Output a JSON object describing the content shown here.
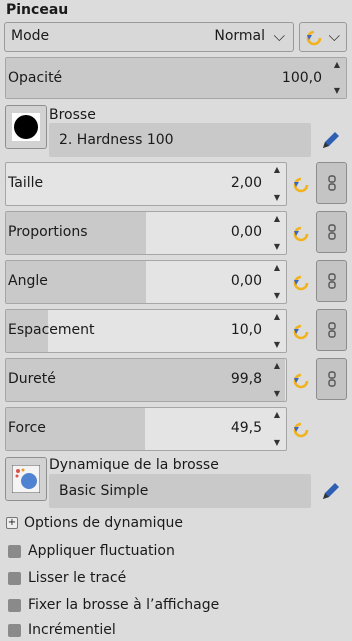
{
  "panel": {
    "title": "Pinceau"
  },
  "mode": {
    "label": "Mode",
    "value": "Normal",
    "reset_icon": "reset-icon"
  },
  "opacity": {
    "label": "Opacité",
    "value": "100,0",
    "fraction": 1.0
  },
  "brush": {
    "label": "Brosse",
    "name": "2. Hardness 100",
    "edit_icon": "pencil-icon"
  },
  "params": [
    {
      "label": "Taille",
      "value": "2,00",
      "fraction": 0.0,
      "chain": true
    },
    {
      "label": "Proportions",
      "value": "0,00",
      "fraction": 0.5,
      "chain": true
    },
    {
      "label": "Angle",
      "value": "0,00",
      "fraction": 0.5,
      "chain": true
    },
    {
      "label": "Espacement",
      "value": "10,0",
      "fraction": 0.15,
      "chain": true
    },
    {
      "label": "Dureté",
      "value": "99,8",
      "fraction": 0.998,
      "chain": true
    },
    {
      "label": "Force",
      "value": "49,5",
      "fraction": 0.495,
      "chain": false
    }
  ],
  "dynamics": {
    "label": "Dynamique de la brosse",
    "name": "Basic Simple",
    "edit_icon": "pencil-icon"
  },
  "dynamics_options": {
    "label": "Options de dynamique"
  },
  "checkboxes": [
    {
      "label": "Appliquer fluctuation",
      "checked": false
    },
    {
      "label": "Lisser le tracé",
      "checked": false
    },
    {
      "label": "Fixer la brosse à l’affichage",
      "checked": false
    },
    {
      "label": "Incrémentiel",
      "checked": false
    }
  ],
  "colors": {
    "accent_reset": "#f2b21c",
    "reset_arrow": "#3b67c4"
  }
}
